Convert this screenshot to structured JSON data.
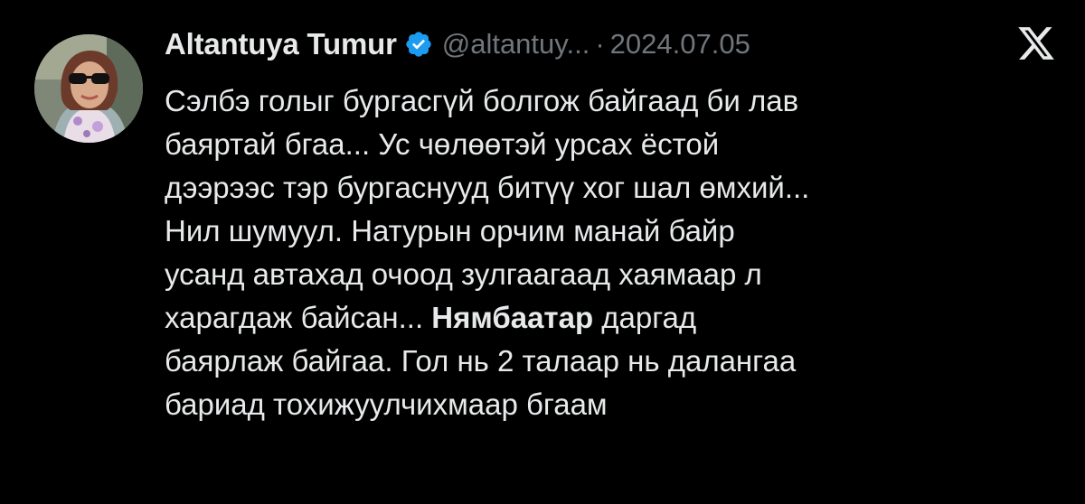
{
  "tweet": {
    "author": {
      "display_name": "Altantuya Tumur",
      "handle": "@altantuy...",
      "verified": true,
      "avatar_icon": "profile-photo"
    },
    "separator": "·",
    "date": "2024.07.05",
    "platform_icon": "x-logo-icon",
    "body_lines": [
      "Сэлбэ голыг бургасгүй болгож байгаад би лав",
      "баяртай бгаа... Ус чөлөөтэй урсах ёстой",
      "дээрээс тэр бургаснууд битүү хог шал өмхий...",
      "Нил шумуул. Натурын орчим манай байр",
      "усанд автахад очоод зулгаагаад хаямаар л"
    ],
    "line6_before": "харагдаж байсан... ",
    "line6_bold": "Нямбаатар",
    "line6_after": " даргад",
    "body_lines_end": [
      "баярлаж байгаа. Гол нь 2 талаар нь далангаа",
      "бариад тохижуулчихмаар бгаам"
    ]
  },
  "colors": {
    "background": "#000000",
    "text": "#e7e9ea",
    "muted": "#71767b",
    "verified_badge": "#1d9bf0"
  }
}
